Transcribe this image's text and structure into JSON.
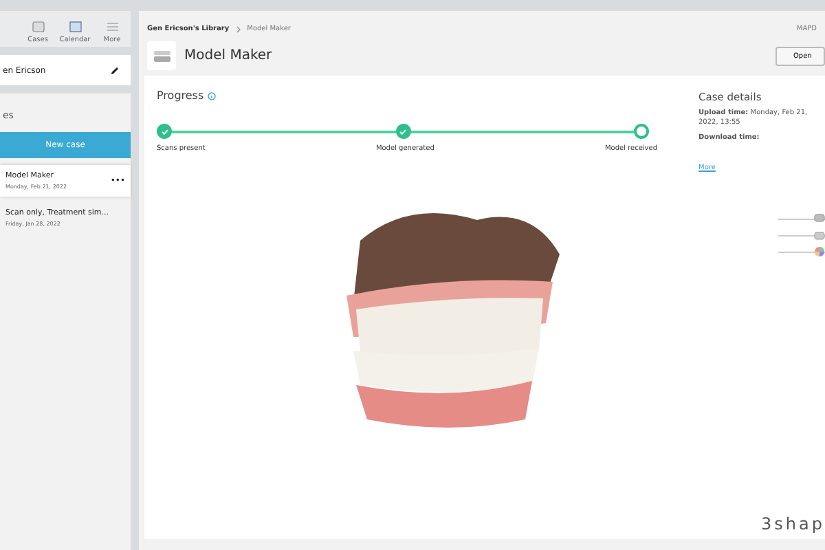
{
  "sidebar": {
    "tabs": [
      {
        "label": "Cases",
        "selected": false
      },
      {
        "label": "Calendar",
        "selected": false
      },
      {
        "label": "More",
        "selected": false
      }
    ],
    "user": {
      "name": "en Ericson"
    },
    "cases_panel": {
      "title": "es",
      "new_case_button": "New case",
      "items": [
        {
          "title": "Model Maker",
          "date": "Monday, Feb 21, 2022",
          "selected": true,
          "menu": "•••"
        },
        {
          "title": "Scan only, Treatment sim...",
          "date": "Friday, Jan 28, 2022",
          "selected": false
        }
      ]
    }
  },
  "breadcrumb": [
    "Gen Ericson's Library",
    "Model Maker"
  ],
  "header_right": "MAPD",
  "page_title": "Model Maker",
  "open_button": "Open",
  "progress": {
    "title": "Progress",
    "steps": [
      {
        "label": "Scans present",
        "done": true
      },
      {
        "label": "Model generated",
        "done": true
      },
      {
        "label": "Model received",
        "done": false
      }
    ]
  },
  "case_details": {
    "title": "Case details",
    "fields": [
      {
        "label": "Upload time:",
        "value": "Monday, Feb 21, 2022, 13:55"
      },
      {
        "label": "Download time:"
      }
    ],
    "link": "More"
  },
  "view_controls": [
    {
      "kind": "upper-jaw",
      "level": 1
    },
    {
      "kind": "lower-jaw",
      "level": 1
    },
    {
      "kind": "color",
      "level": 1
    }
  ],
  "logo": "3shap"
}
